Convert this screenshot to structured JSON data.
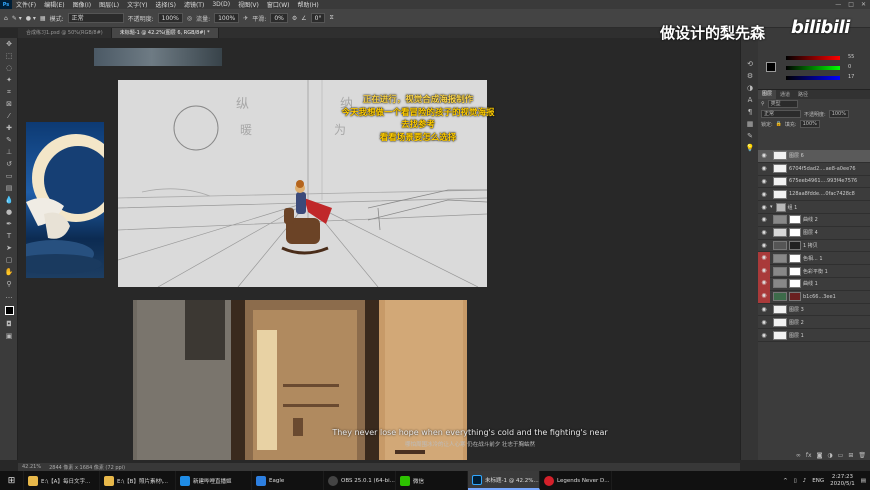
{
  "menubar": {
    "app_logo": "Ps",
    "items": [
      "文件(F)",
      "编辑(E)",
      "图像(I)",
      "图层(L)",
      "文字(Y)",
      "选择(S)",
      "滤镜(T)",
      "3D(D)",
      "视图(V)",
      "窗口(W)",
      "帮助(H)"
    ],
    "win_min": "—",
    "win_max": "□",
    "win_close": "✕"
  },
  "options": {
    "mode_label": "模式:",
    "mode_value": "正常",
    "opacity_label": "不透明度:",
    "opacity_value": "100%",
    "flow_label": "流量:",
    "flow_value": "100%",
    "smooth_label": "平滑:",
    "smooth_value": "0%",
    "angle_value": "0°"
  },
  "tabs": [
    "合成练习1.psd @ 50%(RGB/8#)",
    "未标题-1 @ 42.2%(图层 6, RGB/8#) *"
  ],
  "overlay": {
    "line1": "正在进行，视觉合成海报制作",
    "line2": "今天我想做一个看冒险的孩子的视觉海报",
    "line3": "去找参考",
    "line4": "看看场景要怎么选择"
  },
  "sketch_notes": {
    "left": "纵 暖",
    "right": "纳 为"
  },
  "subtitle": {
    "en": "They never lose hope when everything's cold and the fighting's near",
    "cn": "哪怕周围冰冷的让人心寒 仍在战斗前夕 壮志于胸蛄然"
  },
  "statusbar": {
    "zoom": "42.21%",
    "doc": "2844 像素 x 1684 像素 (72 ppi)"
  },
  "watermark": {
    "author": "做设计的梨先森",
    "brand": "bilibili"
  },
  "color_panel": {
    "r": "55",
    "g": "0",
    "b": "17"
  },
  "layers_panel": {
    "tabs": [
      "图层",
      "通道",
      "路径"
    ],
    "kind_label": "类型",
    "blend": "正常",
    "opacity_label": "不透明度:",
    "opacity": "100%",
    "lock_label": "锁定:",
    "fill_label": "填充:",
    "fill": "100%",
    "layers": [
      {
        "name": "图层 6",
        "selected": true
      },
      {
        "name": "6704f5dad2....ae8-a0ee76",
        "selected": false
      },
      {
        "name": "675eeb4961....993f4e7576",
        "selected": false
      },
      {
        "name": "128aa8fdde....0fac7428c8",
        "selected": false
      },
      {
        "name": "组 1",
        "selected": false
      },
      {
        "name": "曲线 2",
        "selected": false
      },
      {
        "name": "图层 4",
        "selected": false
      },
      {
        "name": "1 拷贝",
        "selected": false
      },
      {
        "name": "色相... 1",
        "selected": false
      },
      {
        "name": "色彩平衡 1",
        "selected": false
      },
      {
        "name": "曲线 1",
        "selected": false
      },
      {
        "name": "b1c66...3ee1",
        "selected": false
      },
      {
        "name": "图层 3",
        "selected": false
      },
      {
        "name": "图层 2",
        "selected": false
      },
      {
        "name": "图层 1",
        "selected": false
      }
    ]
  },
  "taskbar": {
    "items": [
      "E:\\【A】每日文字...",
      "E:\\【B】照片素材\\...",
      "新建哔哩直播姬",
      "Eagle",
      "OBS 25.0.1 (64-bi...",
      "微信",
      "未标题-1 @ 42.2%...",
      "Legends Never D..."
    ],
    "active_index": 6,
    "lang": "ENG",
    "time": "2:27:23",
    "date": "2020/5/1"
  }
}
